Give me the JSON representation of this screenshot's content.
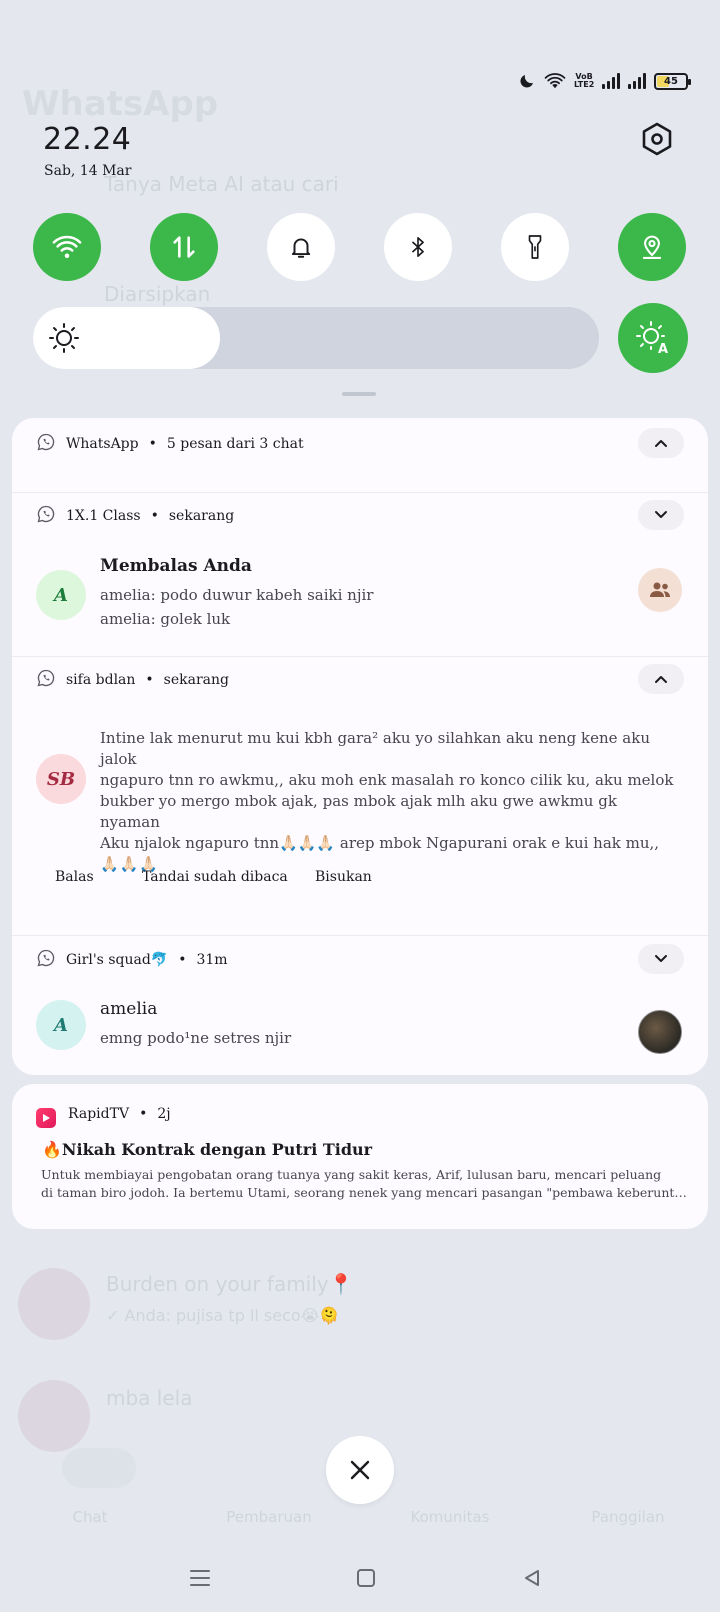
{
  "status_bar": {
    "battery_level": "45",
    "icons": [
      "moon-icon",
      "wifi-icon",
      "volte-icon",
      "signal-icon",
      "signal-icon",
      "battery-icon"
    ],
    "volte_label": "VoB LTE2"
  },
  "shade": {
    "time": "22.24",
    "date": "Sab, 14 Mar",
    "toggles": [
      {
        "name": "wifi",
        "state": "on"
      },
      {
        "name": "mobile-data",
        "state": "on"
      },
      {
        "name": "sound",
        "state": "off"
      },
      {
        "name": "bluetooth",
        "state": "off"
      },
      {
        "name": "flashlight",
        "state": "off"
      },
      {
        "name": "location",
        "state": "on"
      }
    ],
    "brightness_level": 0.33,
    "colors": {
      "active": "#3cb84b",
      "inactive": "#ffffff"
    }
  },
  "whatsapp_group": {
    "header": {
      "app": "WhatsApp",
      "summary": "5 pesan dari 3 chat"
    },
    "notifications": [
      {
        "chat": "1X.1 Class",
        "time": "sekarang",
        "avatar": "A",
        "title": "Membalas Anda",
        "lines": [
          "amelia: podo duwur kabeh saiki njir",
          "amelia: golek luk"
        ]
      },
      {
        "chat": "sifa bdlan",
        "time": "sekarang",
        "avatar": "SB",
        "message_lines": [
          "Intine lak menurut mu kui kbh gara² aku yo silahkan aku neng kene aku jalok",
          "ngapuro tnn ro awkmu,, aku moh enk masalah ro konco cilik ku, aku melok",
          "bukber yo mergo mbok ajak, pas mbok ajak mlh aku gwe awkmu gk nyaman",
          "Aku njalok ngapuro tnn🙏🏻🙏🏻🙏🏻 arep mbok Ngapurani orak e kui hak mu,,",
          "🙏🏻🙏🏻🙏🏻"
        ],
        "actions": [
          "Balas",
          "Tandai sudah dibaca",
          "Bisukan"
        ]
      },
      {
        "chat": "Girl's squad🐬",
        "time": "31m",
        "avatar": "A",
        "title": "amelia",
        "lines": [
          "emng podo¹ne setres njir"
        ]
      }
    ]
  },
  "rapidtv": {
    "app": "RapidTV",
    "time": "2j",
    "title": "🔥Nikah Kontrak dengan Putri Tidur",
    "body_lines": [
      "Untuk membiayai pengobatan orang tuanya yang sakit keras, Arif, lulusan baru, mencari peluang",
      "di taman biro jodoh. Ia bertemu Utami, seorang nenek yang mencari pasangan \"pembawa keberuntu..."
    ]
  },
  "background_app": {
    "title": "WhatsApp",
    "search": "Tanya Meta AI atau cari",
    "archived": "Diarsipkan",
    "chat1": "Burden on your family📍",
    "chat1_preview": "✓ Anda: pujisa tp ll seco😭🫠",
    "chat2": "mba lela",
    "tabs": [
      "Chat",
      "Pembaruan",
      "Komunitas",
      "Panggilan"
    ]
  }
}
